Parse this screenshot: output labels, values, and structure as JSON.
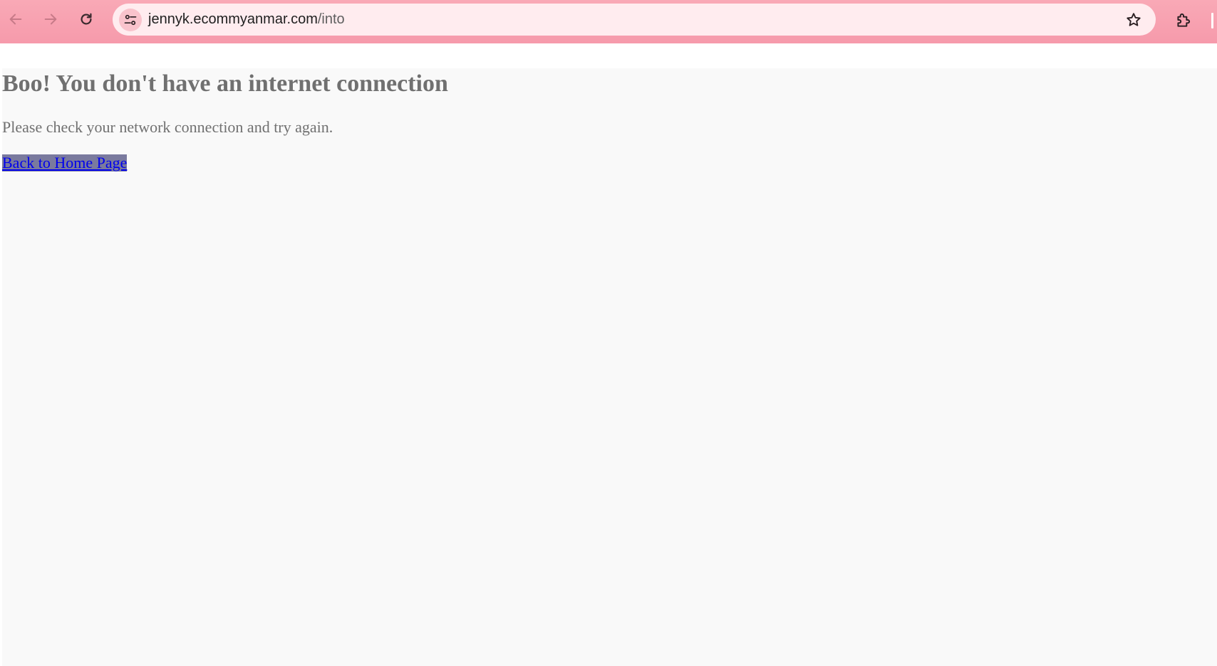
{
  "browser": {
    "url_host": "jennyk.ecommyanmar.com",
    "url_path": "/into",
    "back_icon": "arrow-left-icon",
    "forward_icon": "arrow-right-icon",
    "reload_icon": "reload-icon",
    "site_info_icon": "tune-icon",
    "bookmark_icon": "star-icon",
    "extensions_icon": "puzzle-icon",
    "toolbar_color": "#f7a1b0"
  },
  "page": {
    "heading": "Boo! You don't have an internet connection",
    "message": "Please check your network connection and try again.",
    "home_link": "Back to Home Page"
  }
}
